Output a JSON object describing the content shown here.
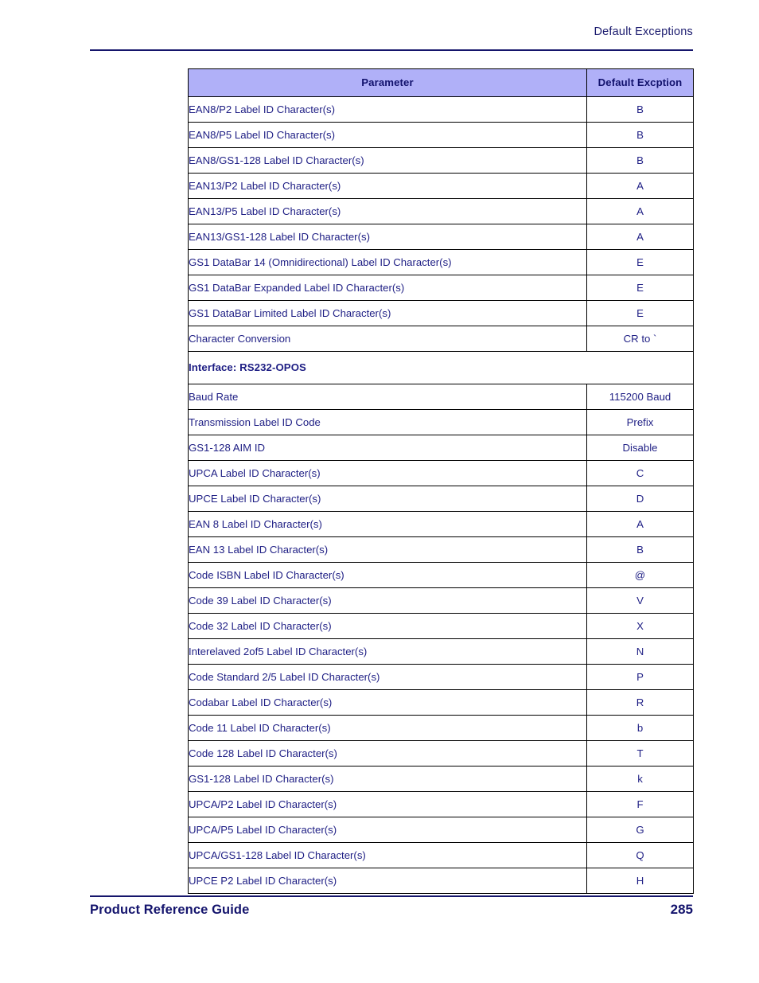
{
  "header": {
    "running_head": "Default Exceptions"
  },
  "table": {
    "columns": [
      "Parameter",
      "Default Excption"
    ],
    "rows": [
      {
        "type": "data",
        "parameter": "EAN8/P2 Label ID Character(s)",
        "value": "B"
      },
      {
        "type": "data",
        "parameter": "EAN8/P5 Label ID Character(s)",
        "value": "B"
      },
      {
        "type": "data",
        "parameter": "EAN8/GS1-128 Label ID Character(s)",
        "value": "B"
      },
      {
        "type": "data",
        "parameter": "EAN13/P2 Label ID Character(s)",
        "value": "A"
      },
      {
        "type": "data",
        "parameter": "EAN13/P5 Label ID Character(s)",
        "value": "A"
      },
      {
        "type": "data",
        "parameter": "EAN13/GS1-128 Label ID Character(s)",
        "value": "A"
      },
      {
        "type": "data",
        "parameter": "GS1 DataBar 14 (Omnidirectional) Label ID Character(s)",
        "value": "E"
      },
      {
        "type": "data",
        "parameter": "GS1 DataBar Expanded Label ID Character(s)",
        "value": "E"
      },
      {
        "type": "data",
        "parameter": "GS1 DataBar Limited Label ID Character(s)",
        "value": "E"
      },
      {
        "type": "data",
        "parameter": "Character Conversion",
        "value": "CR to `"
      },
      {
        "type": "section",
        "parameter": "Interface: RS232-OPOS",
        "value": ""
      },
      {
        "type": "data",
        "parameter": "Baud Rate",
        "value": "115200 Baud"
      },
      {
        "type": "data",
        "parameter": "Transmission Label ID Code",
        "value": "Prefix"
      },
      {
        "type": "data",
        "parameter": "GS1-128 AIM ID",
        "value": "Disable"
      },
      {
        "type": "data",
        "parameter": "UPCA Label ID Character(s)",
        "value": "C"
      },
      {
        "type": "data",
        "parameter": "UPCE Label ID Character(s)",
        "value": "D"
      },
      {
        "type": "data",
        "parameter": "EAN 8 Label ID Character(s)",
        "value": "A"
      },
      {
        "type": "data",
        "parameter": "EAN 13 Label ID Character(s)",
        "value": "B"
      },
      {
        "type": "data",
        "parameter": "Code ISBN Label ID Character(s)",
        "value": "@"
      },
      {
        "type": "data",
        "parameter": "Code 39 Label ID Character(s)",
        "value": "V"
      },
      {
        "type": "data",
        "parameter": "Code 32 Label ID Character(s)",
        "value": "X"
      },
      {
        "type": "data",
        "parameter": "Interelaved 2of5 Label ID Character(s)",
        "value": "N"
      },
      {
        "type": "data",
        "parameter": "Code Standard 2/5 Label ID Character(s)",
        "value": "P"
      },
      {
        "type": "data",
        "parameter": "Codabar Label ID Character(s)",
        "value": "R"
      },
      {
        "type": "data",
        "parameter": "Code 11 Label ID Character(s)",
        "value": "b"
      },
      {
        "type": "data",
        "parameter": "Code 128 Label ID Character(s)",
        "value": "T"
      },
      {
        "type": "data",
        "parameter": "GS1-128 Label ID Character(s)",
        "value": "k"
      },
      {
        "type": "data",
        "parameter": "UPCA/P2 Label ID Character(s)",
        "value": "F"
      },
      {
        "type": "data",
        "parameter": "UPCA/P5 Label ID Character(s)",
        "value": "G"
      },
      {
        "type": "data",
        "parameter": "UPCA/GS1-128 Label ID Character(s)",
        "value": "Q"
      },
      {
        "type": "data",
        "parameter": "UPCE P2 Label ID Character(s)",
        "value": "H"
      }
    ]
  },
  "footer": {
    "title": "Product Reference Guide",
    "page_number": "285"
  },
  "colors": {
    "header_fill": "#b0b0f8",
    "text_blue": "#1e1e84",
    "rule_blue": "#15156b",
    "border": "#000000"
  }
}
